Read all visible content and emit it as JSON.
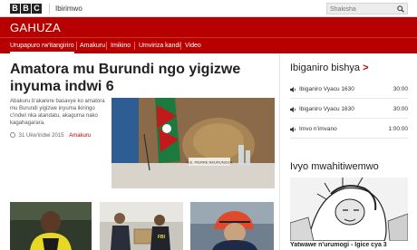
{
  "header": {
    "logo_letters": [
      "B",
      "B",
      "C"
    ],
    "top_link": "Ibirimwo",
    "search_placeholder": "Shakisha",
    "brand_title": "GAHUZA"
  },
  "nav": {
    "items": [
      {
        "label": "Urupapuro rw'itangiriro",
        "active": true
      },
      {
        "label": "Amakuru",
        "active": false
      },
      {
        "label": "Imikino",
        "active": false
      },
      {
        "label": "Umviriza kandi",
        "active": false
      },
      {
        "label": "Video",
        "active": false
      }
    ]
  },
  "main_story": {
    "headline": "Amatora mu Burundi ngo yigizwe inyuma indwi 6",
    "summary": "Abakuru b'akarere basavye ko amatora mu Burundi yigizwe inyuma ikiringo c'indwi nka atandatu, akaguma nako kagahagarara.",
    "date": "31 Ukw'indwi 2015",
    "category": "Amakuru"
  },
  "radio": {
    "title": "Ibiganiro bishya",
    "items": [
      {
        "label": "Ibiganiro Vyacu 1630",
        "time": "30:00"
      },
      {
        "label": "Ibiganiro Vyacu 1630",
        "time": "30:00"
      },
      {
        "label": "Imvo n'imvano",
        "time": "1:00:00"
      }
    ]
  },
  "features": {
    "title": "Ivyo mwahitiwemwo",
    "caption": "Yatwawe n'urumogi - Igice cya 3"
  },
  "colors": {
    "brand_red": "#b80000",
    "text_dark": "#222222",
    "link_red": "#b80000"
  },
  "icons": {
    "search": "search-icon",
    "speaker": "speaker-icon",
    "clock": "clock-icon",
    "chevron": "chevron-right-icon"
  }
}
